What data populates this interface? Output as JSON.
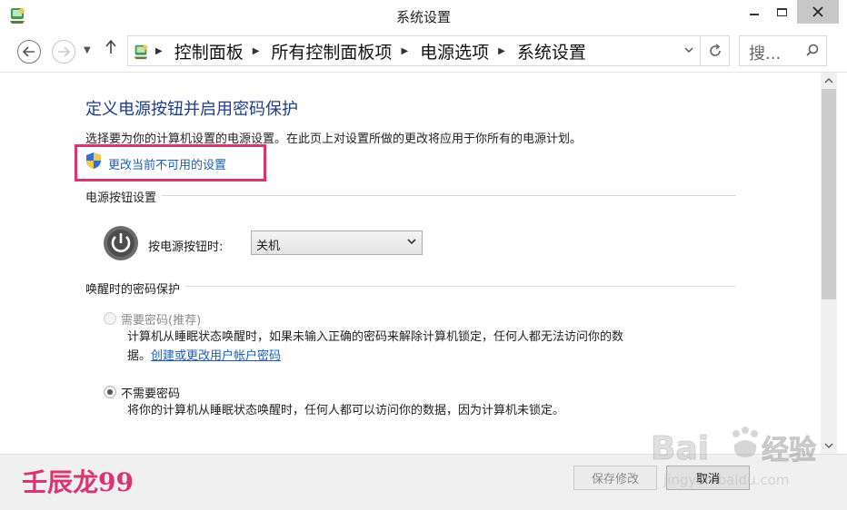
{
  "window": {
    "title": "系统设置"
  },
  "navigation": {
    "breadcrumbs": [
      "控制面板",
      "所有控制面板项",
      "电源选项",
      "系统设置"
    ],
    "search_placeholder": "搜..."
  },
  "content": {
    "heading": "定义电源按钮并启用密码保护",
    "description": "选择要为你的计算机设置的电源设置。在此页上对设置所做的更改将应用于你所有的电源计划。",
    "change_link": "更改当前不可用的设置",
    "power_section": {
      "title": "电源按钮设置",
      "power_button_label": "按电源按钮时:",
      "power_button_value": "关机"
    },
    "wake_section": {
      "title": "唤醒时的密码保护",
      "option_require": {
        "label": "需要密码(推荐)",
        "description": "计算机从睡眠状态唤醒时，如果未输入正确的密码来解除计算机锁定，任何人都无法访问你的数",
        "description_cont": "据。",
        "link": "创建或更改用户帐户密码",
        "selected": false,
        "disabled": true
      },
      "option_no_require": {
        "label": "不需要密码",
        "description": "将你的计算机从睡眠状态唤醒时，任何人都可以访问你的数据，因为计算机未锁定。",
        "selected": true,
        "disabled": true
      }
    }
  },
  "footer": {
    "save_label": "保存修改",
    "cancel_label": "取消"
  },
  "watermark": {
    "left_text": "壬辰龙99"
  },
  "colors": {
    "heading": "#1e3c8c",
    "link": "#1a5fb4",
    "highlight_box": "#d9356f"
  },
  "icons": {
    "app": "control-panel-icon",
    "back": "back-arrow-icon",
    "forward": "forward-arrow-icon",
    "up": "up-arrow-icon",
    "refresh": "refresh-icon",
    "search": "search-icon",
    "shield": "uac-shield-icon",
    "power": "power-icon"
  }
}
